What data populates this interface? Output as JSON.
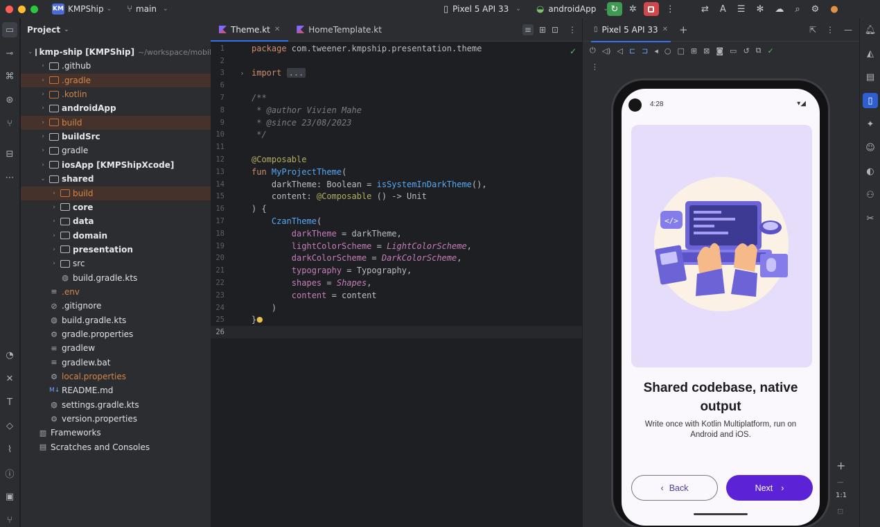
{
  "titlebar": {
    "project_badge": "KM",
    "project_name": "KMPShip",
    "branch": "main",
    "device": "Pixel 5 API 33",
    "run_config": "androidApp"
  },
  "project_panel": {
    "title": "Project",
    "tree": [
      {
        "label": "kmp-ship [KMPShip]",
        "suffix": "~/workspace/mobile/k",
        "depth": 0,
        "expanded": true,
        "icon": "module",
        "style": "bold"
      },
      {
        "label": ".github",
        "depth": 1,
        "icon": "folder"
      },
      {
        "label": ".gradle",
        "depth": 1,
        "icon": "folder-orange",
        "style": "orange",
        "highlight": true
      },
      {
        "label": ".kotlin",
        "depth": 1,
        "icon": "folder-orange",
        "style": "orange"
      },
      {
        "label": "androidApp",
        "depth": 1,
        "icon": "module",
        "style": "bold"
      },
      {
        "label": "build",
        "depth": 1,
        "icon": "folder-orange",
        "style": "orange",
        "highlight": true
      },
      {
        "label": "buildSrc",
        "depth": 1,
        "icon": "module",
        "style": "bold"
      },
      {
        "label": "gradle",
        "depth": 1,
        "icon": "folder"
      },
      {
        "label": "iosApp [KMPShipXcode]",
        "depth": 1,
        "icon": "module",
        "style": "bold"
      },
      {
        "label": "shared",
        "depth": 1,
        "expanded": true,
        "icon": "module",
        "style": "bold"
      },
      {
        "label": "build",
        "depth": 2,
        "icon": "folder-orange",
        "style": "orange",
        "highlight": true
      },
      {
        "label": "core",
        "depth": 2,
        "icon": "folder",
        "style": "semibold"
      },
      {
        "label": "data",
        "depth": 2,
        "icon": "folder",
        "style": "semibold"
      },
      {
        "label": "domain",
        "depth": 2,
        "icon": "folder",
        "style": "semibold"
      },
      {
        "label": "presentation",
        "depth": 2,
        "icon": "folder",
        "style": "semibold"
      },
      {
        "label": "src",
        "depth": 2,
        "icon": "folder"
      },
      {
        "label": "build.gradle.kts",
        "depth": 2,
        "icon": "gradle-file",
        "leaf": true
      },
      {
        "label": ".env",
        "depth": 1,
        "icon": "text-file",
        "style": "orange",
        "leaf": true
      },
      {
        "label": ".gitignore",
        "depth": 1,
        "icon": "ignore-file",
        "leaf": true
      },
      {
        "label": "build.gradle.kts",
        "depth": 1,
        "icon": "gradle-file",
        "leaf": true
      },
      {
        "label": "gradle.properties",
        "depth": 1,
        "icon": "settings-file",
        "leaf": true
      },
      {
        "label": "gradlew",
        "depth": 1,
        "icon": "text-file",
        "leaf": true
      },
      {
        "label": "gradlew.bat",
        "depth": 1,
        "icon": "text-file",
        "leaf": true
      },
      {
        "label": "local.properties",
        "depth": 1,
        "icon": "settings-file",
        "style": "orange",
        "leaf": true
      },
      {
        "label": "README.md",
        "depth": 1,
        "icon": "markdown-file",
        "leaf": true
      },
      {
        "label": "settings.gradle.kts",
        "depth": 1,
        "icon": "gradle-file",
        "leaf": true
      },
      {
        "label": "version.properties",
        "depth": 1,
        "icon": "settings-file",
        "leaf": true
      },
      {
        "label": "Frameworks",
        "depth": 0,
        "icon": "library",
        "leaf": true
      },
      {
        "label": "Scratches and Consoles",
        "depth": 0,
        "icon": "scratches",
        "leaf": true
      }
    ]
  },
  "editor": {
    "tabs": [
      {
        "label": "Theme.kt",
        "active": true
      },
      {
        "label": "HomeTemplate.kt",
        "active": false
      }
    ],
    "lines": [
      {
        "n": "1",
        "t": "package com.tweener.kmpship.presentation.theme"
      },
      {
        "n": "2",
        "t": ""
      },
      {
        "n": "3",
        "t": "import ..."
      },
      {
        "n": "6",
        "t": ""
      },
      {
        "n": "7",
        "t": "/**"
      },
      {
        "n": "8",
        "t": " * @author Vivien Mahe"
      },
      {
        "n": "9",
        "t": " * @since 23/08/2023"
      },
      {
        "n": "10",
        "t": " */"
      },
      {
        "n": "11",
        "t": ""
      },
      {
        "n": "12",
        "t": "@Composable"
      },
      {
        "n": "13",
        "t": "fun MyProjectTheme("
      },
      {
        "n": "14",
        "t": "    darkTheme: Boolean = isSystemInDarkTheme(),"
      },
      {
        "n": "15",
        "t": "    content: @Composable () -> Unit"
      },
      {
        "n": "16",
        "t": ") {"
      },
      {
        "n": "17",
        "t": "    CzanTheme("
      },
      {
        "n": "18",
        "t": "        darkTheme = darkTheme,"
      },
      {
        "n": "19",
        "t": "        lightColorScheme = LightColorScheme,"
      },
      {
        "n": "20",
        "t": "        darkColorScheme = DarkColorScheme,"
      },
      {
        "n": "21",
        "t": "        typography = Typography,"
      },
      {
        "n": "22",
        "t": "        shapes = Shapes,"
      },
      {
        "n": "23",
        "t": "        content = content"
      },
      {
        "n": "24",
        "t": "    )"
      },
      {
        "n": "25",
        "t": "}"
      },
      {
        "n": "26",
        "t": ""
      }
    ]
  },
  "emulator": {
    "tab_label": "Pixel 5 API 33",
    "zoom_label": "1:1",
    "phone": {
      "time": "4:28",
      "headline": "Shared codebase, native output",
      "subtitle": "Write once with Kotlin Multiplatform, run on Android and iOS.",
      "back_label": "Back",
      "next_label": "Next"
    }
  },
  "colors": {
    "accent": "#3574f0",
    "run_green": "#3f9b52",
    "stop_red": "#d2484a",
    "phone_primary": "#5b22d6",
    "hero_bg": "#e6ddfb"
  }
}
